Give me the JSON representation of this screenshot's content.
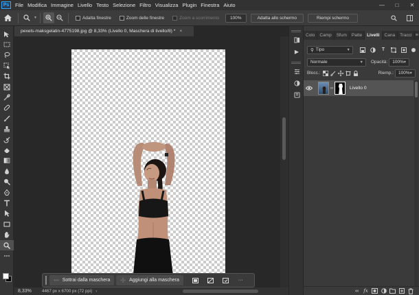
{
  "app": {
    "logo_text": "Ps",
    "menu": [
      "File",
      "Modifica",
      "Immagine",
      "Livello",
      "Testo",
      "Selezione",
      "Filtro",
      "Visualizza",
      "Plugin",
      "Finestra",
      "Aiuto"
    ]
  },
  "options_bar": {
    "adatta_finestre": "Adatta finestre",
    "zoom_finestre": "Zoom delle finestre",
    "zoom_scorrimento": "Zoom a scorrimento",
    "zoom_value": "100%",
    "adatta_schermo": "Adatta allo schermo",
    "riempi_schermo": "Riempi schermo"
  },
  "document": {
    "tab_title": "pexels-maksgelatin-4775198.jpg @ 8,33% (Livello 0, Maschera di livello/8) *",
    "close": "×"
  },
  "taskbar": {
    "subtract": "Sottrai dalla maschera",
    "add": "Aggiungi alla maschera",
    "more": "···"
  },
  "status": {
    "zoom": "8,33%",
    "size": "4467 px x 6700 px (72 ppi)"
  },
  "layers_panel": {
    "tabs": [
      "Colo",
      "Camp",
      "Sfum",
      "Patte",
      "Livelli",
      "Cana",
      "Tracci"
    ],
    "active_tab": "Livelli",
    "filter_kind": "Tipo",
    "blend_mode": "Normale",
    "opacity_label": "Opacità:",
    "opacity_value": "100%",
    "lock_label": "Blocc.:",
    "fill_label": "Riemp.:",
    "fill_value": "100%",
    "layers": [
      {
        "name": "Livello 0",
        "visible": true,
        "has_mask": true
      }
    ]
  },
  "colors": {
    "accent": "#31a8ff",
    "panel": "#3a3a3a",
    "canvas_bg": "#282828",
    "checker_light": "#ffffff",
    "checker_dark": "#cccccc"
  }
}
